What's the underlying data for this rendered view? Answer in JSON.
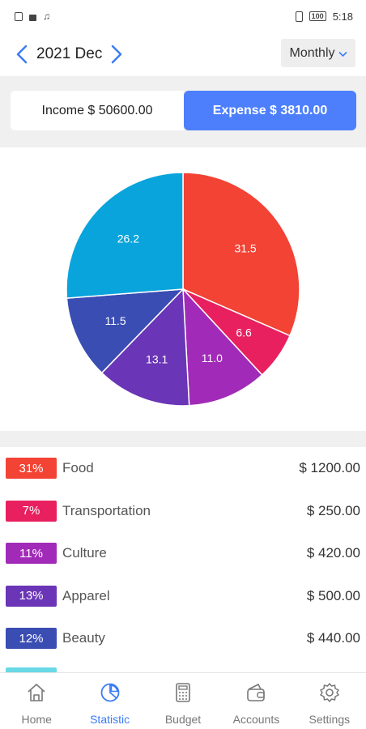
{
  "status_bar": {
    "time": "5:18",
    "battery": "100"
  },
  "header": {
    "month": "2021 Dec",
    "period": "Monthly"
  },
  "summary": {
    "income_label": "Income $ 50600.00",
    "expense_label": "Expense $ 3810.00"
  },
  "chart_data": {
    "type": "pie",
    "slices": [
      {
        "value": 31.5,
        "label": "31.5",
        "color": "#f24335"
      },
      {
        "value": 6.6,
        "label": "6.6",
        "color": "#e8205f"
      },
      {
        "value": 11.0,
        "label": "11.0",
        "color": "#a12bb8"
      },
      {
        "value": 13.1,
        "label": "13.1",
        "color": "#6a35b6"
      },
      {
        "value": 11.5,
        "label": "11.5",
        "color": "#3a4db3"
      },
      {
        "value": 26.2,
        "label": "26.2",
        "color": "#0aa4dc"
      }
    ]
  },
  "categories": [
    {
      "percent": "31%",
      "name": "Food",
      "amount": "$ 1200.00",
      "color": "#f24335"
    },
    {
      "percent": "7%",
      "name": "Transportation",
      "amount": "$ 250.00",
      "color": "#e8205f"
    },
    {
      "percent": "11%",
      "name": "Culture",
      "amount": "$ 420.00",
      "color": "#a12bb8"
    },
    {
      "percent": "13%",
      "name": "Apparel",
      "amount": "$ 500.00",
      "color": "#6a35b6"
    },
    {
      "percent": "12%",
      "name": "Beauty",
      "amount": "$ 440.00",
      "color": "#3a4db3"
    }
  ],
  "bottom_nav": [
    {
      "label": "Home",
      "icon": "home-icon",
      "active": false
    },
    {
      "label": "Statistic",
      "icon": "pie-chart-icon",
      "active": true
    },
    {
      "label": "Budget",
      "icon": "calculator-icon",
      "active": false
    },
    {
      "label": "Accounts",
      "icon": "wallet-icon",
      "active": false
    },
    {
      "label": "Settings",
      "icon": "gear-icon",
      "active": false
    }
  ],
  "colors": {
    "accent": "#4d7ffc",
    "nav_active": "#3b7cf5"
  }
}
